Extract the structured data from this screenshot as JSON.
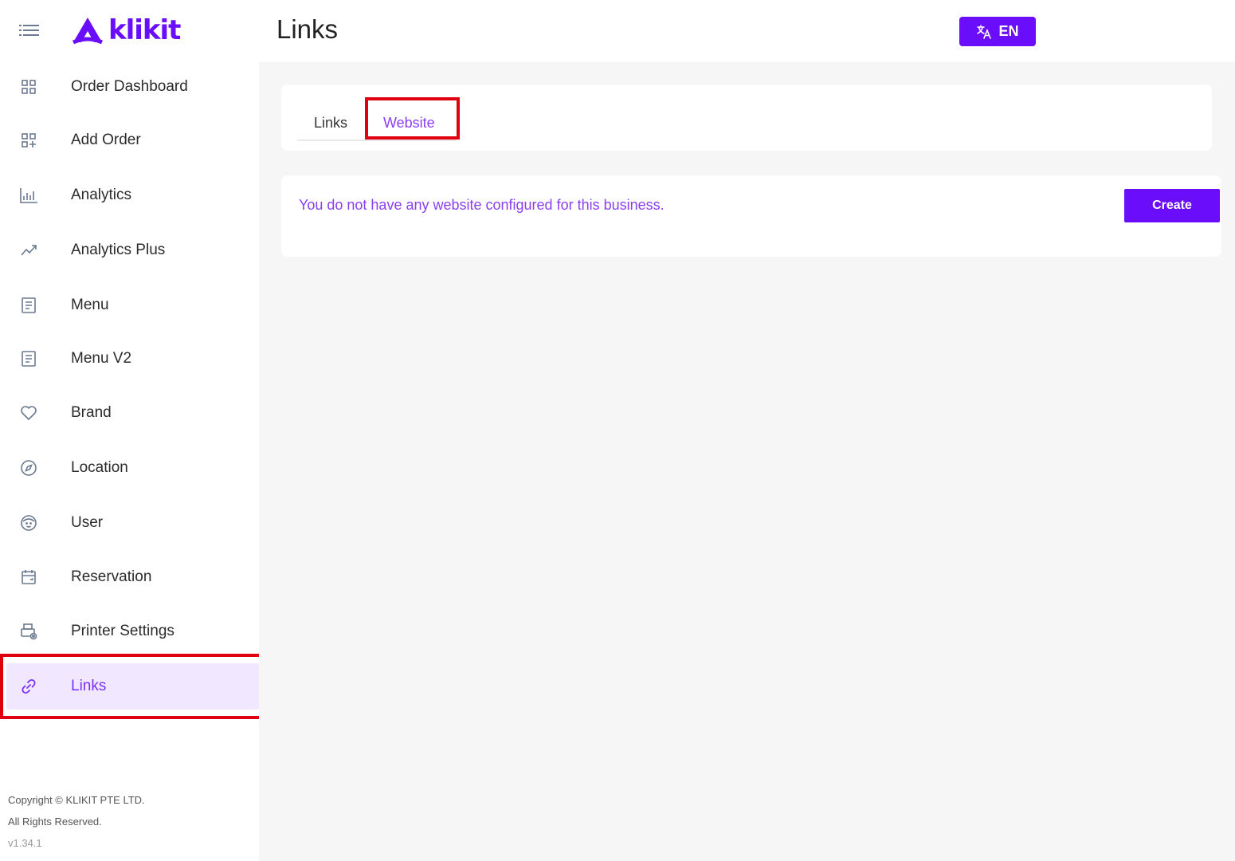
{
  "brand": {
    "name": "klikit",
    "accent": "#6a0dfb"
  },
  "header": {
    "title": "Links",
    "language_label": "EN"
  },
  "sidebar": {
    "items": [
      {
        "label": "Order Dashboard",
        "icon": "grid-icon"
      },
      {
        "label": "Add Order",
        "icon": "add-grid-icon"
      },
      {
        "label": "Analytics",
        "icon": "bar-chart-icon"
      },
      {
        "label": "Analytics Plus",
        "icon": "trend-icon"
      },
      {
        "label": "Menu",
        "icon": "document-icon"
      },
      {
        "label": "Menu V2",
        "icon": "document-icon"
      },
      {
        "label": "Brand",
        "icon": "heart-icon"
      },
      {
        "label": "Location",
        "icon": "compass-icon"
      },
      {
        "label": "User",
        "icon": "face-icon"
      },
      {
        "label": "Reservation",
        "icon": "calendar-icon"
      },
      {
        "label": "Printer Settings",
        "icon": "printer-icon"
      },
      {
        "label": "Links",
        "icon": "link-icon",
        "active": true
      }
    ],
    "footer": {
      "copyright": "Copyright © KLIKIT PTE LTD.",
      "rights": "All Rights Reserved.",
      "version": "v1.34.1"
    }
  },
  "tabs": [
    {
      "label": "Links"
    },
    {
      "label": "Website",
      "active": true
    }
  ],
  "website": {
    "empty_message": "You do not have any website configured for this business.",
    "create_label": "Create"
  }
}
